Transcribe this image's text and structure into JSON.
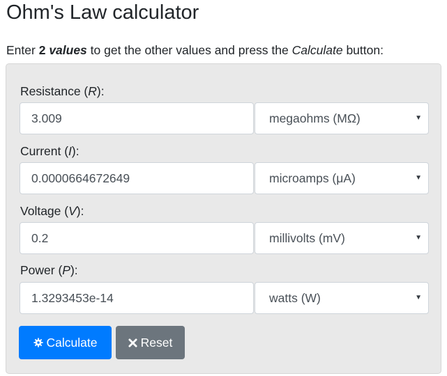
{
  "page": {
    "title": "Ohm's Law calculator"
  },
  "instructions": {
    "prefix": "Enter ",
    "bold_count": "2 ",
    "bold_italic_word": "values",
    "middle": " to get the other values and press the ",
    "button_ref": "Calculate",
    "suffix": " button:"
  },
  "fields": [
    {
      "label_prefix": "Resistance (",
      "symbol": "R",
      "label_suffix": "):",
      "value": "3.009",
      "unit": "megaohms (MΩ)"
    },
    {
      "label_prefix": "Current (",
      "symbol": "I",
      "label_suffix": "):",
      "value": "0.0000664672649",
      "unit": "microamps (μA)"
    },
    {
      "label_prefix": "Voltage (",
      "symbol": "V",
      "label_suffix": "):",
      "value": "0.2",
      "unit": "millivolts (mV)"
    },
    {
      "label_prefix": "Power (",
      "symbol": "P",
      "label_suffix": "):",
      "value": "1.3293453e-14",
      "unit": "watts (W)"
    }
  ],
  "caret": "▼",
  "buttons": {
    "calculate": {
      "label": "Calculate",
      "icon": "gear-icon",
      "color": "#007bff"
    },
    "reset": {
      "label": "Reset",
      "icon": "close-icon",
      "color": "#6c757d"
    }
  }
}
